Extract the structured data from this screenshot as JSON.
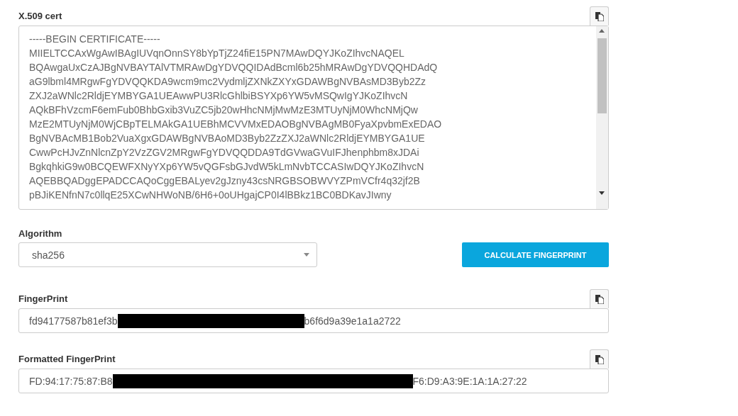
{
  "certificate": {
    "label": "X.509 cert",
    "lines": [
      "-----BEGIN CERTIFICATE-----",
      "MIIELTCCAxWgAwIBAgIUVqnOnnSY8bYpTjZ24fiE15PN7MAwDQYJKoZIhvcNAQEL",
      "BQAwgaUxCzAJBgNVBAYTAlVTMRAwDgYDVQQIDAdBcml6b25hMRAwDgYDVQQHDAdQ",
      "aG9lbml4MRgwFgYDVQQKDA9wcm9mc2VydmljZXNkZXYxGDAWBgNVBAsMD3Byb2Zz",
      "ZXJ2aWNlc2RldjEYMBYGA1UEAwwPU3RlcGhlbiBSYXp6YW5vMSQwIgYJKoZIhvcN",
      "AQkBFhVzcmF6emFub0BhbGxib3VuZC5jb20wHhcNMjMwMzE3MTUyNjM0WhcNMjQw",
      "MzE2MTUyNjM0WjCBpTELMAkGA1UEBhMCVVMxEDAOBgNVBAgMB0FyaXpvbmExEDAO",
      "BgNVBAcMB1Bob2VuaXgxGDAWBgNVBAoMD3Byb2ZzZXJ2aWNlc2RldjEYMBYGA1UE",
      "CwwPcHJvZnNlcnZpY2VzZGV2MRgwFgYDVQQDDA9TdGVwaGVuIFJhenphbm8xJDAi",
      "BgkqhkiG9w0BCQEWFXNyYXp6YW5vQGFsbGJvdW5kLmNvbTCCASIwDQYJKoZIhvcN",
      "AQEBBQADggEPADCCAQoCggEBALyev2gJzny43csNRGBSOBWVYZPmVCfr4q32jf2B",
      "pBJiKENfnN7c0llqE25XCwNHWoNB/6H6+0oUHgajCP0I4lBBkz1BC0BDKavJIwny"
    ]
  },
  "algorithm": {
    "label": "Algorithm",
    "value": "sha256"
  },
  "calculate_button": "CALCULATE FINGERPRINT",
  "outputs": [
    {
      "label": "FingerPrint",
      "value_before": "fd94177587b81ef3b",
      "value_after": "b6f6d9a39e1a1a2722",
      "redacted": true
    },
    {
      "label": "Formatted FingerPrint",
      "value_before": "FD:94:17:75:87:B8",
      "value_after": "F6:D9:A3:9E:1A:1A:27:22",
      "redacted": true
    }
  ]
}
